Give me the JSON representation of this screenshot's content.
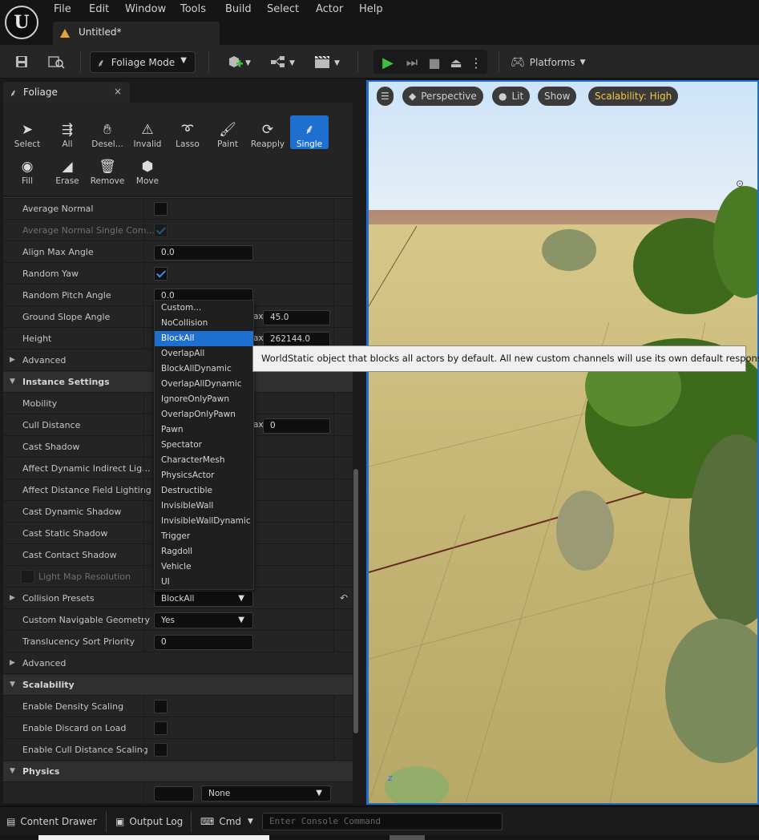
{
  "menubar": {
    "items": [
      "File",
      "Edit",
      "Window",
      "Tools",
      "Build",
      "Select",
      "Actor",
      "Help"
    ]
  },
  "document_tab": {
    "title": "Untitled*"
  },
  "toolbar": {
    "mode_label": "Foliage Mode",
    "platforms_label": "Platforms"
  },
  "panel": {
    "tab_label": "Foliage",
    "close": "×",
    "tools": [
      "Select",
      "All",
      "Desel...",
      "Invalid",
      "Lasso",
      "Paint",
      "Reapply",
      "Single",
      "Fill",
      "Erase",
      "Remove",
      "Move"
    ],
    "active_tool": "Single"
  },
  "properties": {
    "average_normal": "Average Normal",
    "average_normal_single": "Average Normal Single Com...",
    "align_max_angle": "Align Max Angle",
    "align_max_angle_value": "0.0",
    "random_yaw": "Random Yaw",
    "random_pitch_angle": "Random Pitch Angle",
    "random_pitch_value": "0.0",
    "ground_slope_angle": "Ground Slope Angle",
    "ground_slope_max_label": "ax",
    "ground_slope_max": "45.0",
    "height": "Height",
    "height_max_label": "ax",
    "height_max": "262144.0",
    "advanced": "Advanced",
    "instance_settings": "Instance Settings",
    "mobility": "Mobility",
    "cull_distance": "Cull Distance",
    "cull_max_label": "ax",
    "cull_max": "0",
    "cast_shadow": "Cast Shadow",
    "affect_dynamic_indirect": "Affect Dynamic Indirect Lig...",
    "affect_distance_field": "Affect Distance Field Lighting",
    "cast_dynamic_shadow": "Cast Dynamic Shadow",
    "cast_static_shadow": "Cast Static Shadow",
    "cast_contact_shadow": "Cast Contact Shadow",
    "light_map_resolution": "Light Map Resolution",
    "collision_presets": "Collision Presets",
    "collision_presets_value": "BlockAll",
    "custom_nav_geometry": "Custom Navigable Geometry",
    "custom_nav_value": "Yes",
    "translucency_sort": "Translucency Sort Priority",
    "translucency_value": "0",
    "advanced2": "Advanced",
    "scalability": "Scalability",
    "enable_density_scaling": "Enable Density Scaling",
    "enable_discard_on_load": "Enable Discard on Load",
    "enable_cull_distance_scaling": "Enable Cull Distance Scaling",
    "physics": "Physics",
    "physics_none": "None"
  },
  "dropdown": {
    "options": [
      "Custom...",
      "NoCollision",
      "BlockAll",
      "OverlapAll",
      "BlockAllDynamic",
      "OverlapAllDynamic",
      "IgnoreOnlyPawn",
      "OverlapOnlyPawn",
      "Pawn",
      "Spectator",
      "CharacterMesh",
      "PhysicsActor",
      "Destructible",
      "InvisibleWall",
      "InvisibleWallDynamic",
      "Trigger",
      "Ragdoll",
      "Vehicle",
      "UI"
    ],
    "selected": "BlockAll"
  },
  "tooltip": {
    "text": "WorldStatic object that blocks all actors by default. All new custom channels will use its own default response."
  },
  "viewport": {
    "perspective": "Perspective",
    "lit": "Lit",
    "show": "Show",
    "scalability": "Scalability: High"
  },
  "bottombar": {
    "content_drawer": "Content Drawer",
    "output_log": "Output Log",
    "cmd": "Cmd",
    "console_placeholder": "Enter Console Command"
  },
  "colors": {
    "accent": "#1f6fd1",
    "scalability_text": "#f2c744",
    "play_green": "#3fbf3f"
  }
}
